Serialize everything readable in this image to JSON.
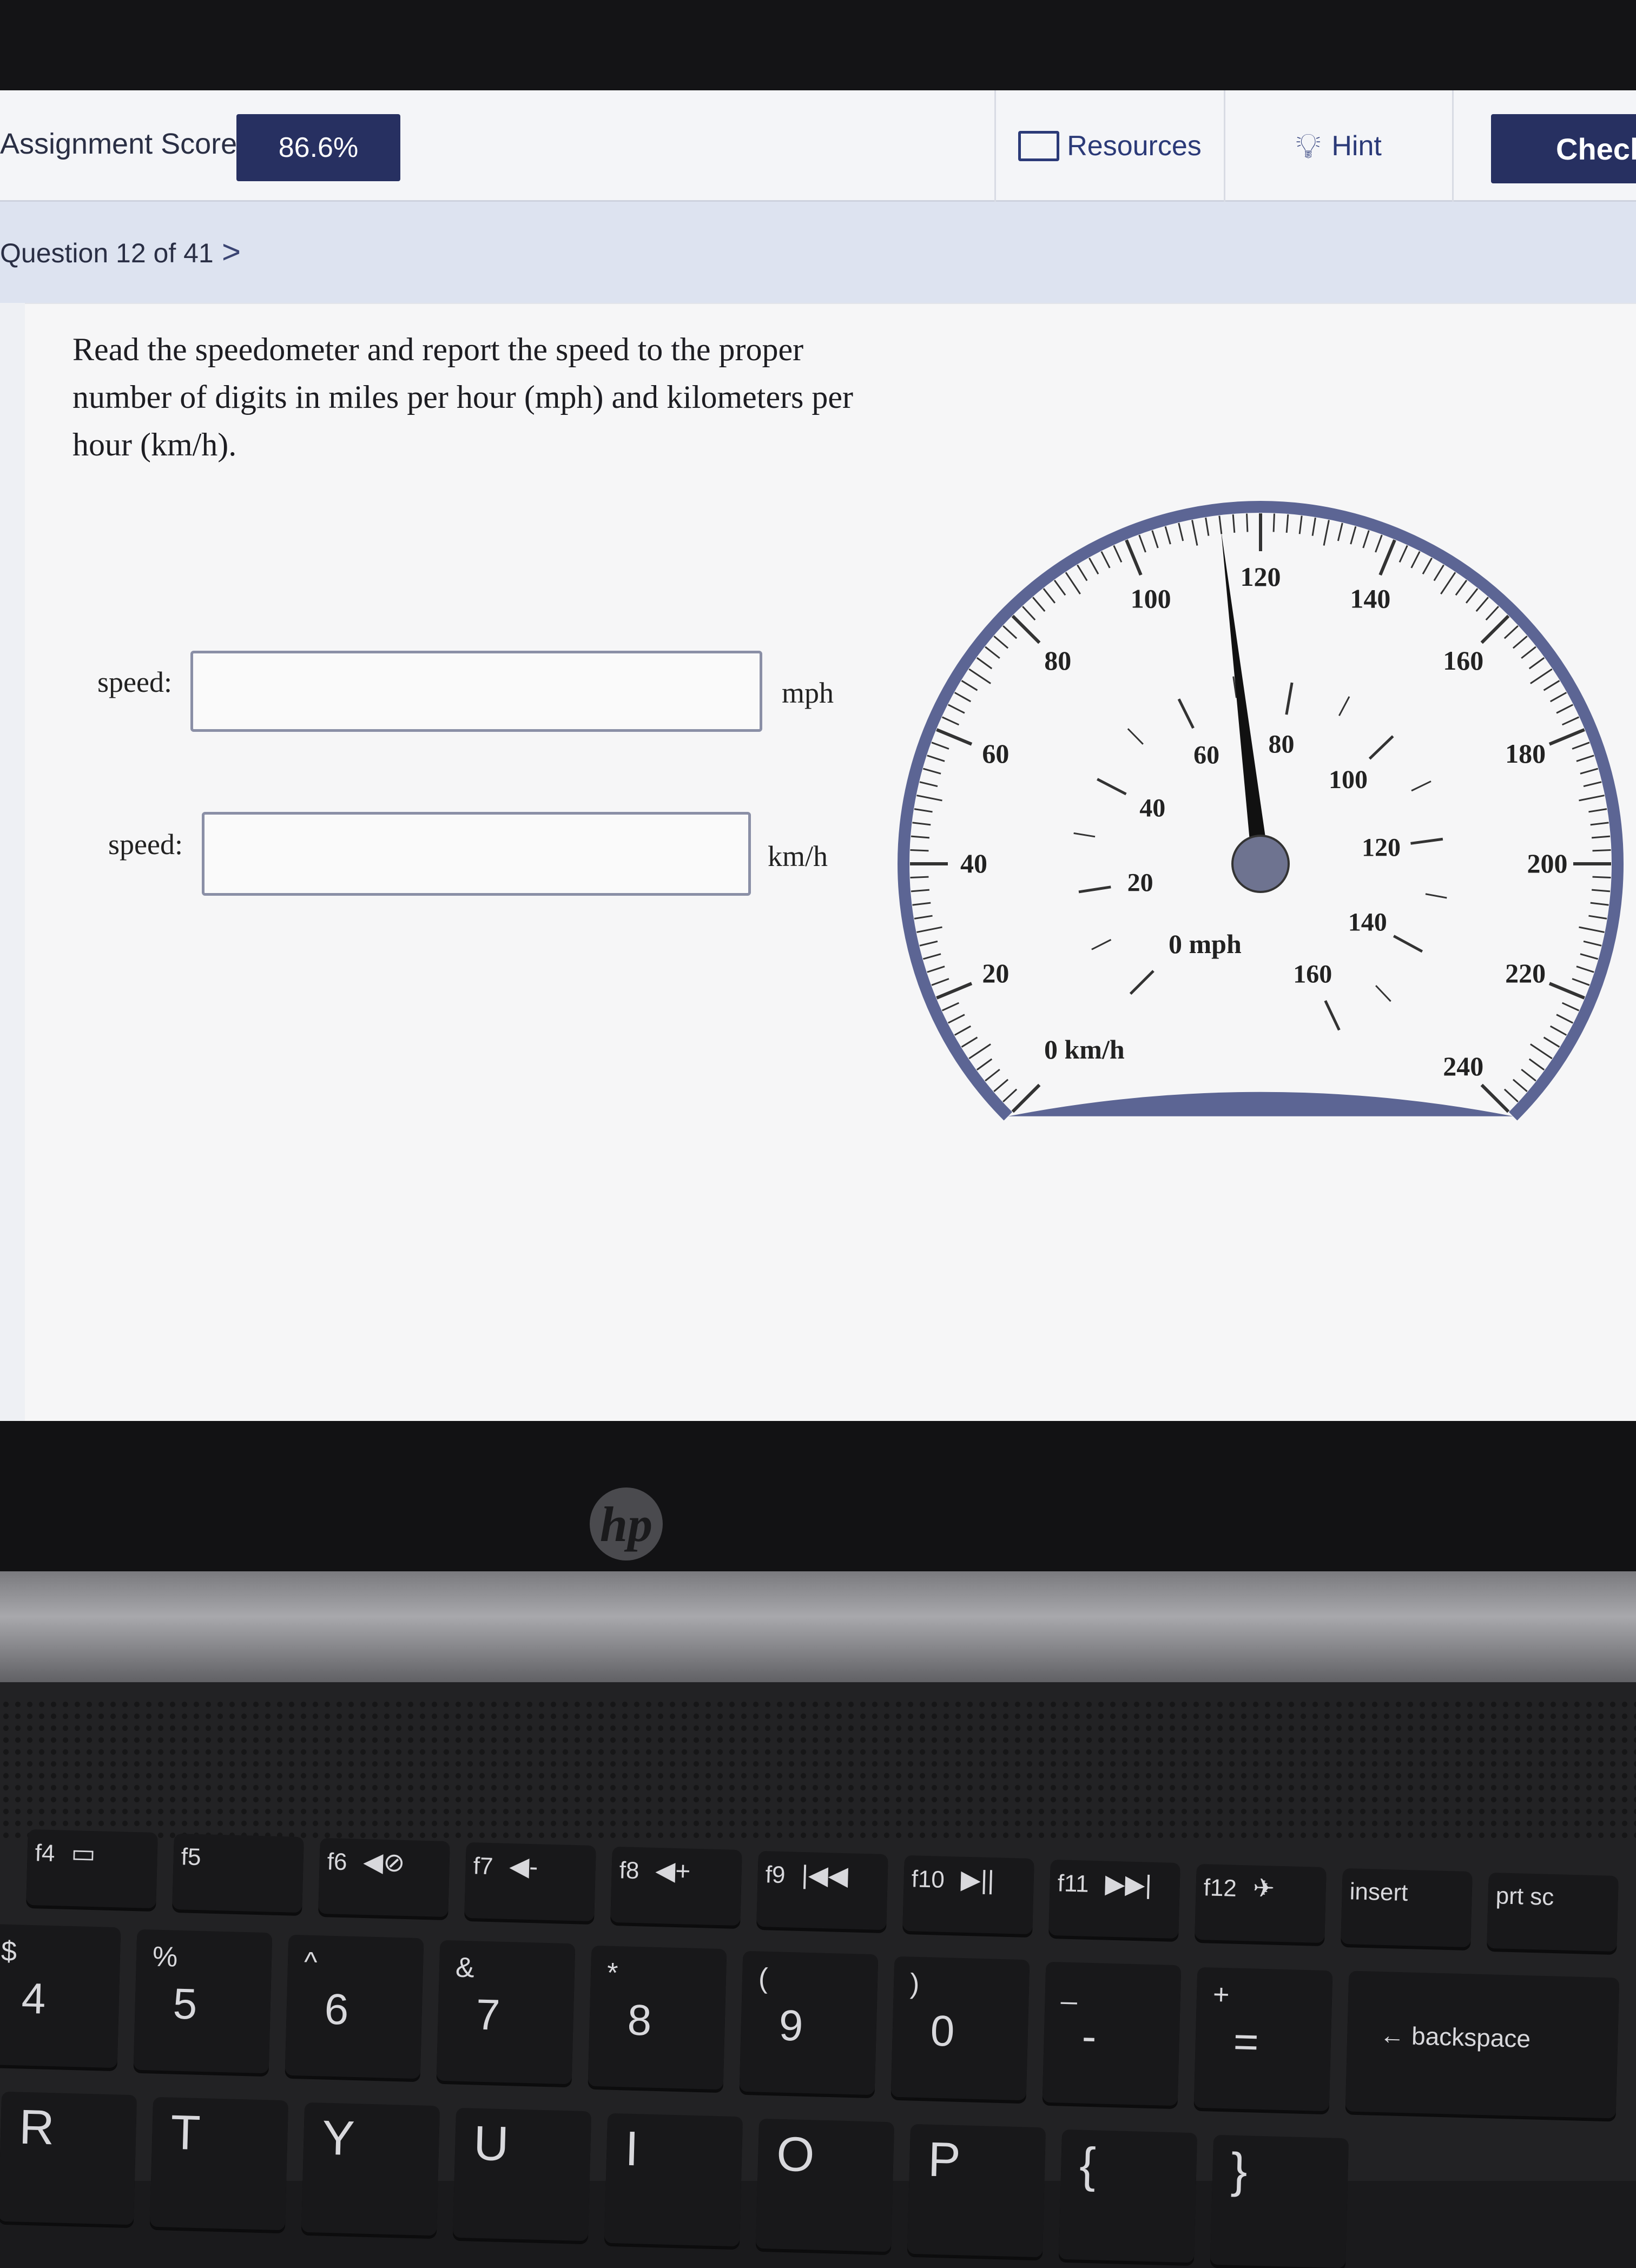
{
  "header": {
    "score_label": "Assignment Score:",
    "score_value": "86.6%",
    "resources": "Resources",
    "hint": "Hint",
    "check": "Check"
  },
  "question_bar": {
    "label": "Question 12 of 41",
    "next_icon": "chevron-right"
  },
  "question": {
    "text": "Read the speedometer and report the speed to the proper number of digits in miles per hour (mph) and kilometers per hour (km/h).",
    "fields": [
      {
        "label": "speed:",
        "value": "",
        "unit": "mph"
      },
      {
        "label": "speed:",
        "value": "",
        "unit": "km/h"
      }
    ]
  },
  "speedometer": {
    "outer_unit_label": "0 km/h",
    "outer_labels": [
      "20",
      "40",
      "60",
      "80",
      "100",
      "120",
      "140",
      "160",
      "180",
      "200",
      "220",
      "240"
    ],
    "inner_unit_label": "0 mph",
    "inner_labels": [
      "20",
      "40",
      "60",
      "80",
      "100",
      "120",
      "140",
      "160"
    ],
    "outer_max_kmh": 240,
    "inner_max_mph": 160,
    "needle_kmh": 114,
    "colors": {
      "rim": "#5c6594",
      "hub": "#6e7390",
      "needle": "#111111"
    }
  },
  "laptop": {
    "logo": "hp"
  },
  "keyboard": {
    "function_row": [
      {
        "fn": "f4",
        "icon": "▭"
      },
      {
        "fn": "f5",
        "icon": ""
      },
      {
        "fn": "f6",
        "icon": "◀⊘"
      },
      {
        "fn": "f7",
        "icon": "◀-"
      },
      {
        "fn": "f8",
        "icon": "◀+"
      },
      {
        "fn": "f9",
        "icon": "|◀◀"
      },
      {
        "fn": "f10",
        "icon": "▶||"
      },
      {
        "fn": "f11",
        "icon": "▶▶|"
      },
      {
        "fn": "f12",
        "icon": "✈"
      },
      {
        "fn": "insert",
        "icon": ""
      },
      {
        "fn": "prt sc",
        "icon": ""
      }
    ],
    "number_row": [
      {
        "shift": "$",
        "main": "4"
      },
      {
        "shift": "%",
        "main": "5"
      },
      {
        "shift": "^",
        "main": "6"
      },
      {
        "shift": "&",
        "main": "7"
      },
      {
        "shift": "*",
        "main": "8"
      },
      {
        "shift": "(",
        "main": "9"
      },
      {
        "shift": ")",
        "main": "0"
      },
      {
        "shift": "_",
        "main": "-"
      },
      {
        "shift": "+",
        "main": "="
      },
      {
        "shift": "",
        "main": "← backspace"
      }
    ],
    "letter_row": [
      "R",
      "T",
      "Y",
      "U",
      "I",
      "O",
      "P",
      "{",
      "}"
    ]
  }
}
